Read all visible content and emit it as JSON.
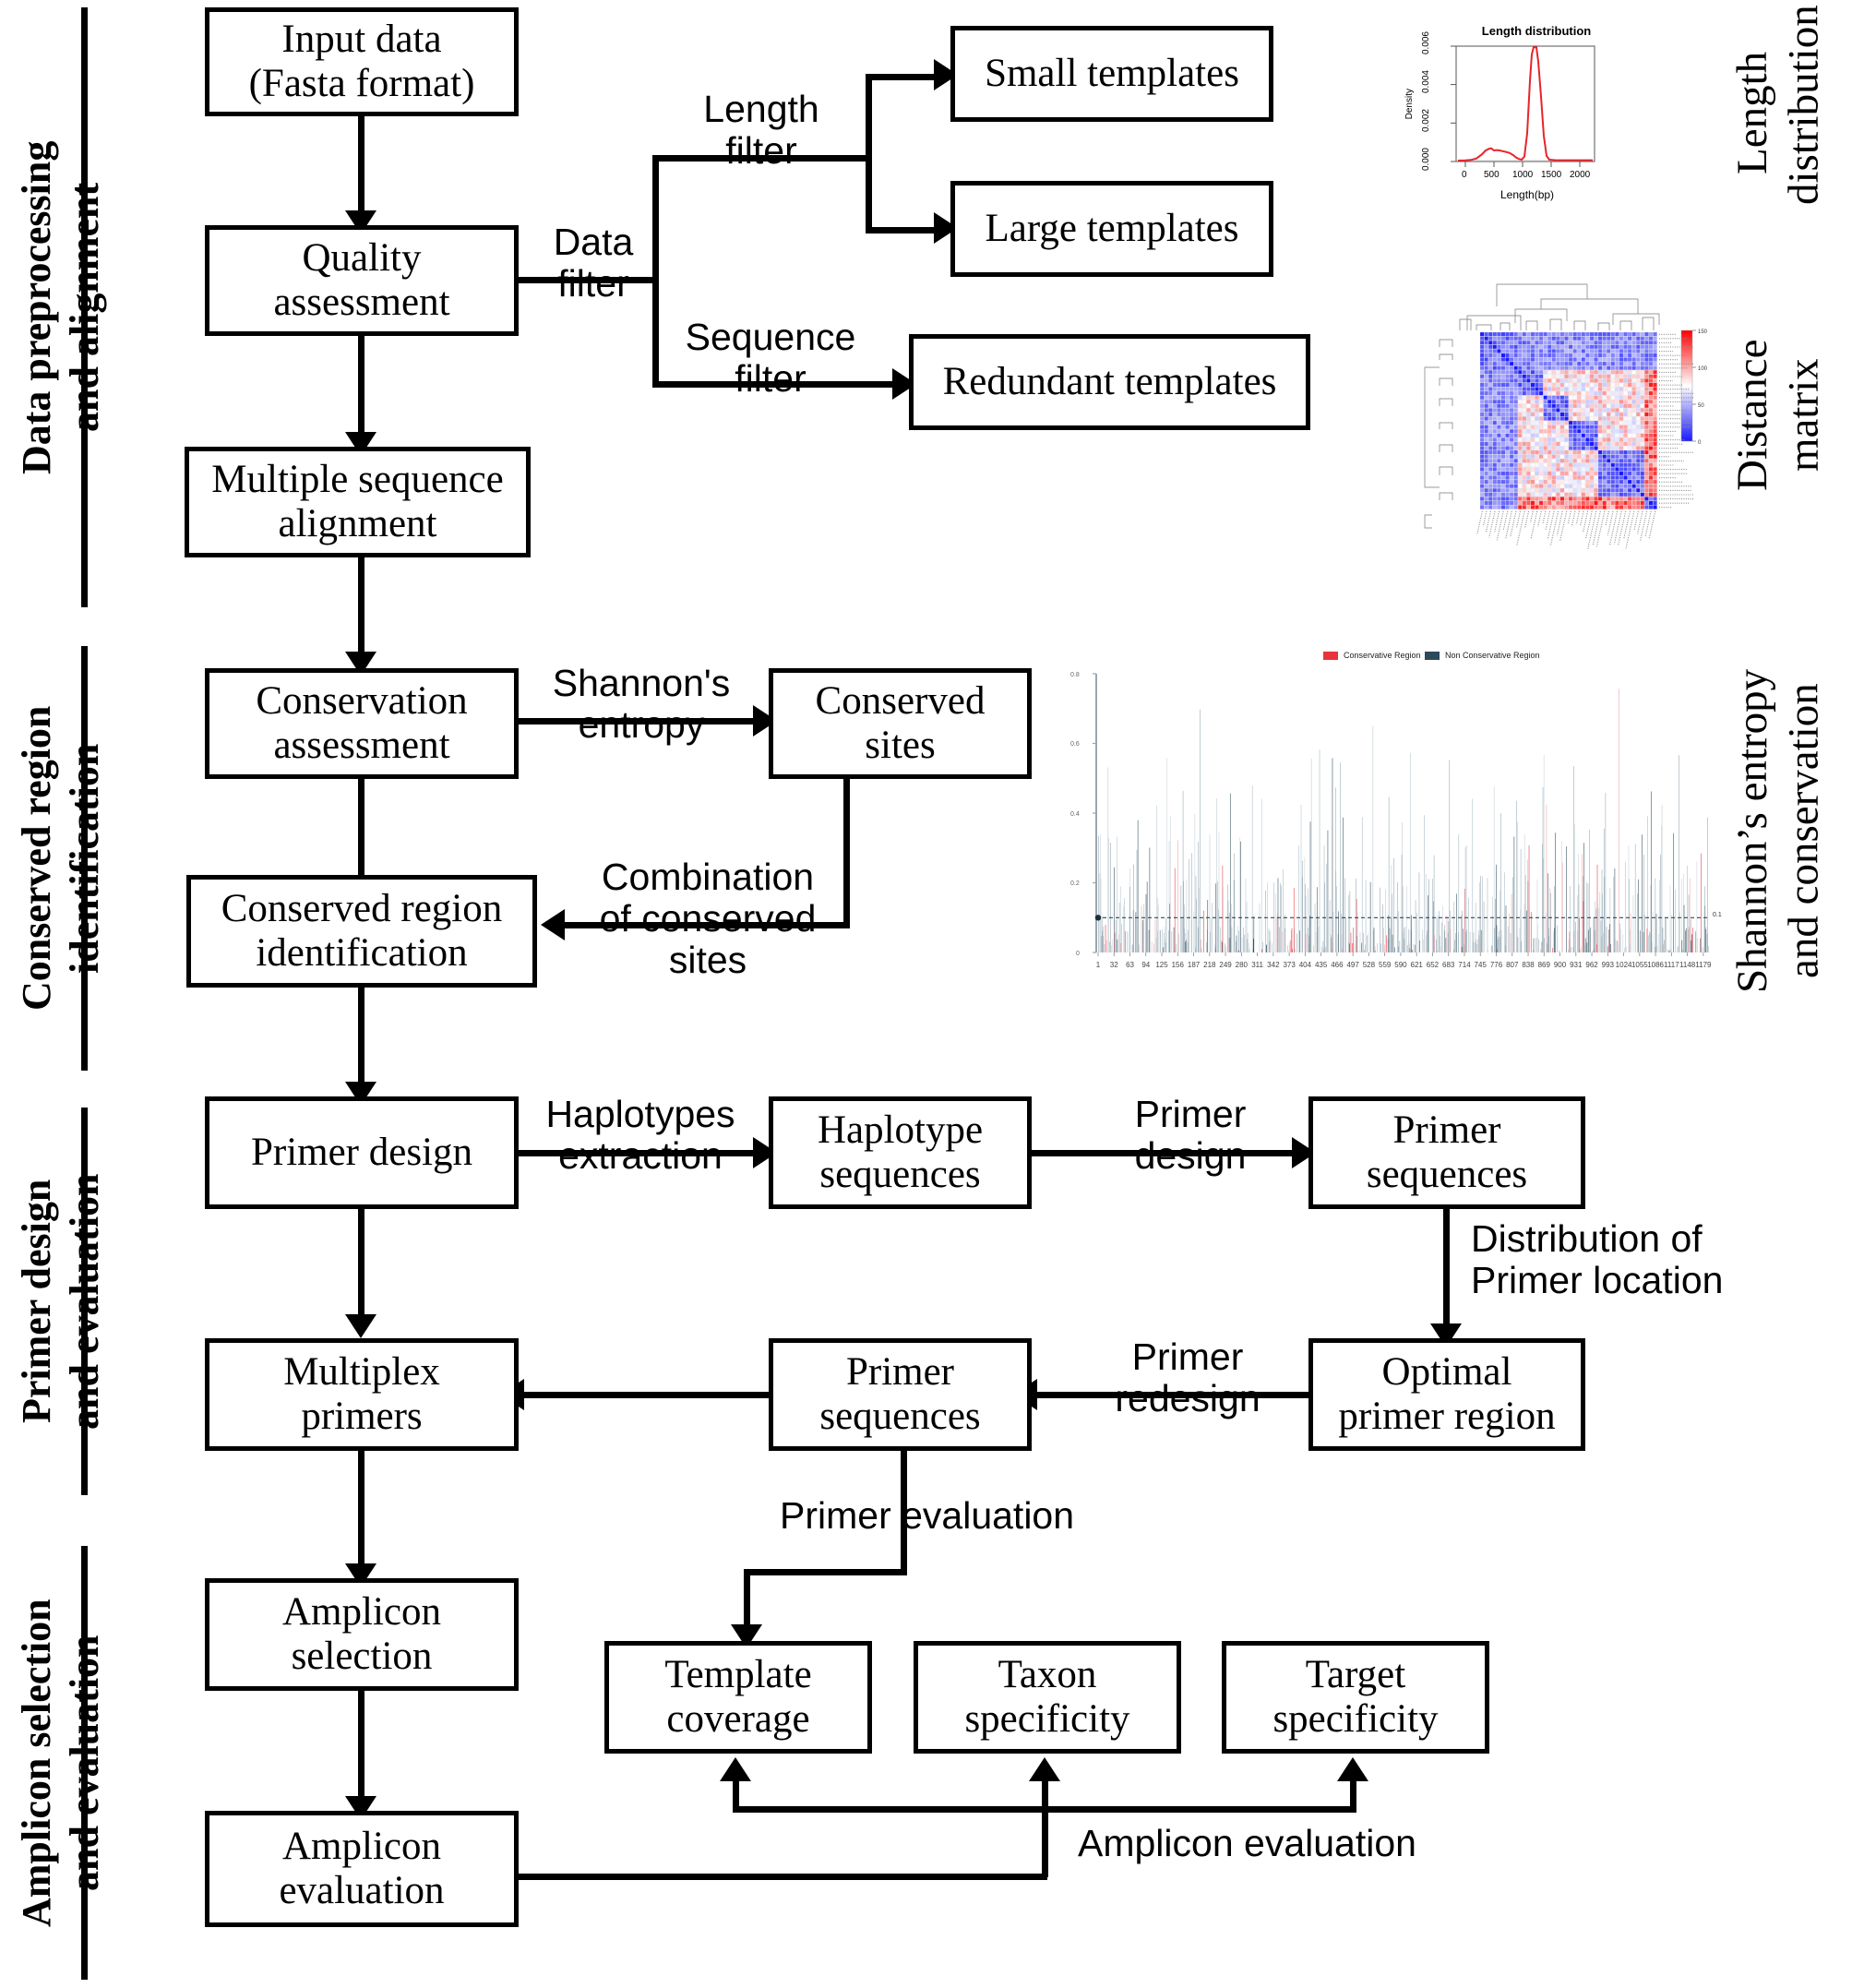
{
  "sections": [
    {
      "id": "data-preprocessing",
      "label": "Data preprocessing\nand alignment"
    },
    {
      "id": "conserved-region",
      "label": "Conserved region\nidentification"
    },
    {
      "id": "primer-design",
      "label": "Primer design\nand evaluation"
    },
    {
      "id": "amplicon-selection",
      "label": "Amplicon selection\nand evaluation"
    }
  ],
  "panel_labels": [
    {
      "id": "length-distribution",
      "label": "Length\ndistribution"
    },
    {
      "id": "distance-matrix",
      "label": "Distance\nmatrix"
    },
    {
      "id": "shannon-entropy",
      "label": "Shannon’s entropy\nand conservation"
    }
  ],
  "nodes": {
    "input_data": "Input data\n(Fasta format)",
    "quality_assessment": "Quality\nassessment",
    "multiple_sequence_alignment": "Multiple sequence\nalignment",
    "small_templates": "Small templates",
    "large_templates": "Large templates",
    "redundant_templates": "Redundant templates",
    "conservation_assessment": "Conservation\nassessment",
    "conserved_sites": "Conserved\nsites",
    "conserved_region_identification": "Conserved region\nidentification",
    "primer_design": "Primer design",
    "haplotype_sequences": "Haplotype\nsequences",
    "primer_sequences_top": "Primer\nsequences",
    "optimal_primer_region": "Optimal\nprimer region",
    "primer_sequences_bottom": "Primer\nsequences",
    "multiplex_primers": "Multiplex\nprimers",
    "amplicon_selection": "Amplicon\nselection",
    "amplicon_evaluation": "Amplicon\nevaluation",
    "template_coverage": "Template\ncoverage",
    "taxon_specificity": "Taxon\nspecificity",
    "target_specificity": "Target\nspecificity"
  },
  "edges": {
    "data_filter": "Data\nfilter",
    "length_filter": "Length\nfilter",
    "sequence_filter": "Sequence\nfilter",
    "shannons_entropy": "Shannon's\nentropy",
    "combination_of_conserved_sites": "Combination\nof conserved\nsites",
    "haplotypes_extraction": "Haplotypes\nextraction",
    "primer_design_edge": "Primer\ndesign",
    "distribution_of_primer_location": "Distribution of\nPrimer location",
    "primer_redesign": "Primer\nredesign",
    "primer_evaluation": "Primer evaluation",
    "amplicon_evaluation_edge": "Amplicon evaluation"
  },
  "chart_data": [
    {
      "id": "length-distribution",
      "type": "line",
      "title": "Length distribution",
      "xlabel": "Length(bp)",
      "ylabel": "Density",
      "xticks": [
        0,
        500,
        1000,
        1500,
        2000
      ],
      "yticks": [
        "0.000",
        "0.002",
        "0.004",
        "0.006"
      ],
      "xlim": [
        -80,
        2230
      ],
      "ylim": [
        0,
        0.0065
      ],
      "grid": false,
      "legend": "none",
      "line_color": "#e8242a",
      "x": [
        -60,
        0,
        100,
        200,
        300,
        380,
        440,
        470,
        520,
        560,
        600,
        640,
        700,
        760,
        820,
        880,
        930,
        980,
        1030,
        1080,
        1120,
        1150,
        1180,
        1200,
        1230,
        1260,
        1290,
        1330,
        1380,
        1500,
        1700,
        1900,
        2100,
        2220
      ],
      "y": [
        2e-05,
        3e-05,
        5e-05,
        0.00012,
        0.00033,
        0.00055,
        0.00066,
        0.00068,
        0.00058,
        0.0006,
        0.00058,
        0.00054,
        0.0005,
        0.00044,
        0.00032,
        0.00018,
        0.0001,
        6e-05,
        0.0002,
        0.0014,
        0.0042,
        0.0056,
        0.006,
        0.00598,
        0.0052,
        0.0033,
        0.0013,
        0.0003,
        5e-05,
        3e-05,
        3e-05,
        3e-05,
        3e-05,
        3e-05
      ]
    },
    {
      "id": "distance-matrix",
      "type": "heatmap",
      "title": "",
      "colorbar_ticks": [
        0,
        50,
        100,
        150
      ],
      "colorbar_low_color": "#1a1aff",
      "colorbar_mid_color": "#ffffff",
      "colorbar_high_color": "#ff0000",
      "rows": 42,
      "cols": 42,
      "has_row_dendrogram": true,
      "has_col_dendrogram": true,
      "legend": "right"
    },
    {
      "id": "shannon-entropy",
      "type": "bar",
      "title": "",
      "xlabel": "",
      "ylabel": "",
      "ylim": [
        0,
        0.8
      ],
      "yticks": [
        0,
        0.2,
        0.4,
        0.6,
        0.8
      ],
      "threshold": 0.1,
      "threshold_label": "0.1",
      "xticks": [
        1,
        32,
        63,
        94,
        125,
        156,
        187,
        218,
        249,
        280,
        311,
        342,
        373,
        404,
        435,
        466,
        497,
        528,
        559,
        590,
        621,
        652,
        683,
        714,
        745,
        776,
        807,
        838,
        869,
        900,
        931,
        962,
        993,
        1024,
        1055,
        1086,
        1117,
        1148,
        1179
      ],
      "grid": false,
      "legend": "top",
      "series": [
        {
          "name": "Conservative Region",
          "color": "#e8343c"
        },
        {
          "name": "Non Conservative Region",
          "color": "#2d4a5a"
        }
      ]
    }
  ]
}
